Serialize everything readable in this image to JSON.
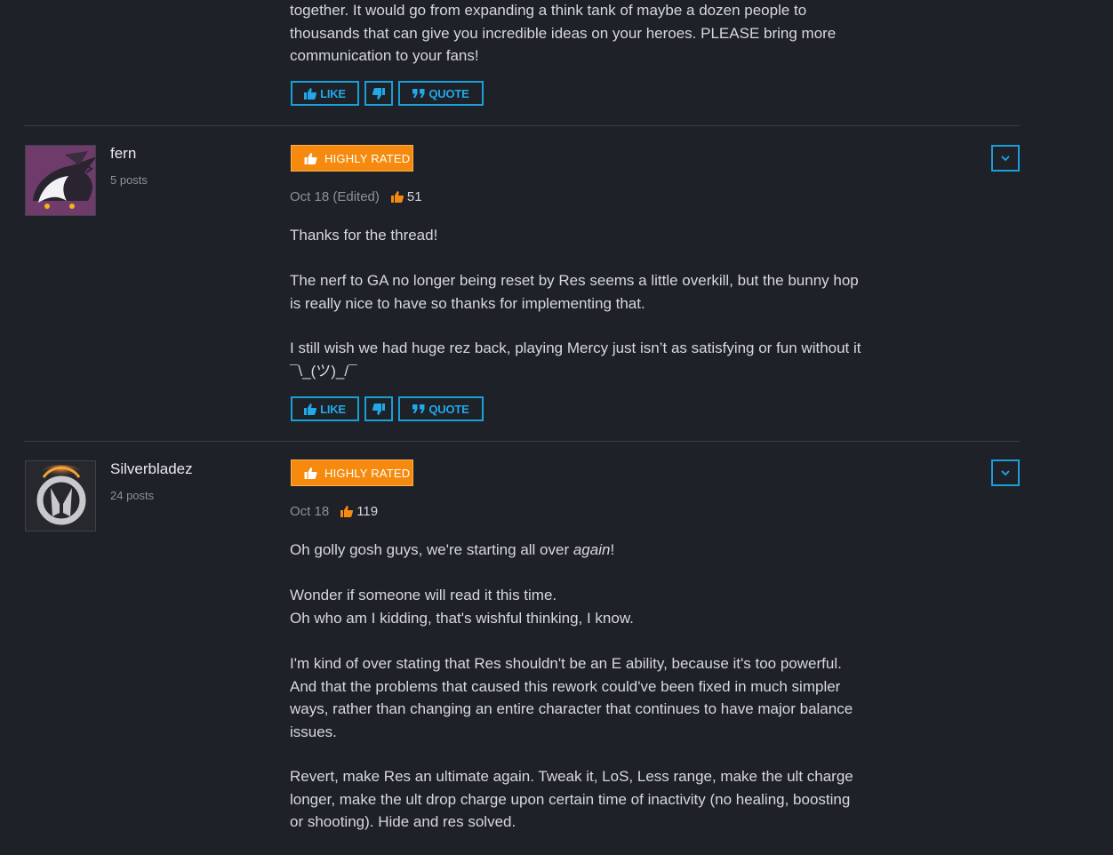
{
  "top_post": {
    "lines": [
      "together. It would go from expanding a think tank of maybe a dozen people to",
      "thousands that can give you incredible ideas on your heroes. PLEASE bring more",
      "communication to your fans!"
    ],
    "like_label": "LIKE",
    "quote_label": "QUOTE"
  },
  "posts": [
    {
      "username": "fern",
      "post_count": "5 posts",
      "badge": "HIGHLY RATED",
      "date": "Oct 18 (Edited)",
      "likes": "51",
      "paragraphs": [
        [
          "Thanks for the thread!"
        ],
        [
          "The nerf to GA no longer being reset by Res seems a little overkill, but the bunny hop",
          "is really nice to have so thanks for implementing that."
        ],
        [
          "I still wish we had huge rez back, playing Mercy just isn’t as satisfying or fun without it",
          "¯\\_(ツ)_/¯"
        ]
      ],
      "like_label": "LIKE",
      "quote_label": "QUOTE"
    },
    {
      "username": "Silverbladez",
      "post_count": "24 posts",
      "badge": "HIGHLY RATED",
      "date": "Oct 18",
      "likes": "119",
      "intro_pre": "Oh golly gosh guys, we're starting all over ",
      "intro_em": "again",
      "intro_post": "!",
      "paragraphs": [
        [
          "Wonder if someone will read it this time.",
          "Oh who am I kidding, that's wishful thinking, I know."
        ],
        [
          "I'm kind of over stating that Res shouldn't be an E ability, because it's too powerful.",
          "And that the problems that caused this rework could've been fixed in much simpler",
          "ways, rather than changing an entire character that continues to have major balance",
          "issues."
        ],
        [
          "Revert, make Res an ultimate again. Tweak it, LoS, Less range, make the ult charge",
          "longer, make the ult drop charge upon certain time of inactivity (no healing, boosting",
          "or shooting). Hide and res solved."
        ]
      ]
    }
  ],
  "colors": {
    "background": "#1f2128",
    "accent_blue": "#1a9fd9",
    "badge_orange": "#f58a0f",
    "like_orange": "#f58a0f"
  },
  "icons": [
    "thumbs-up-icon",
    "thumbs-down-icon",
    "quote-icon",
    "chevron-down-icon"
  ]
}
